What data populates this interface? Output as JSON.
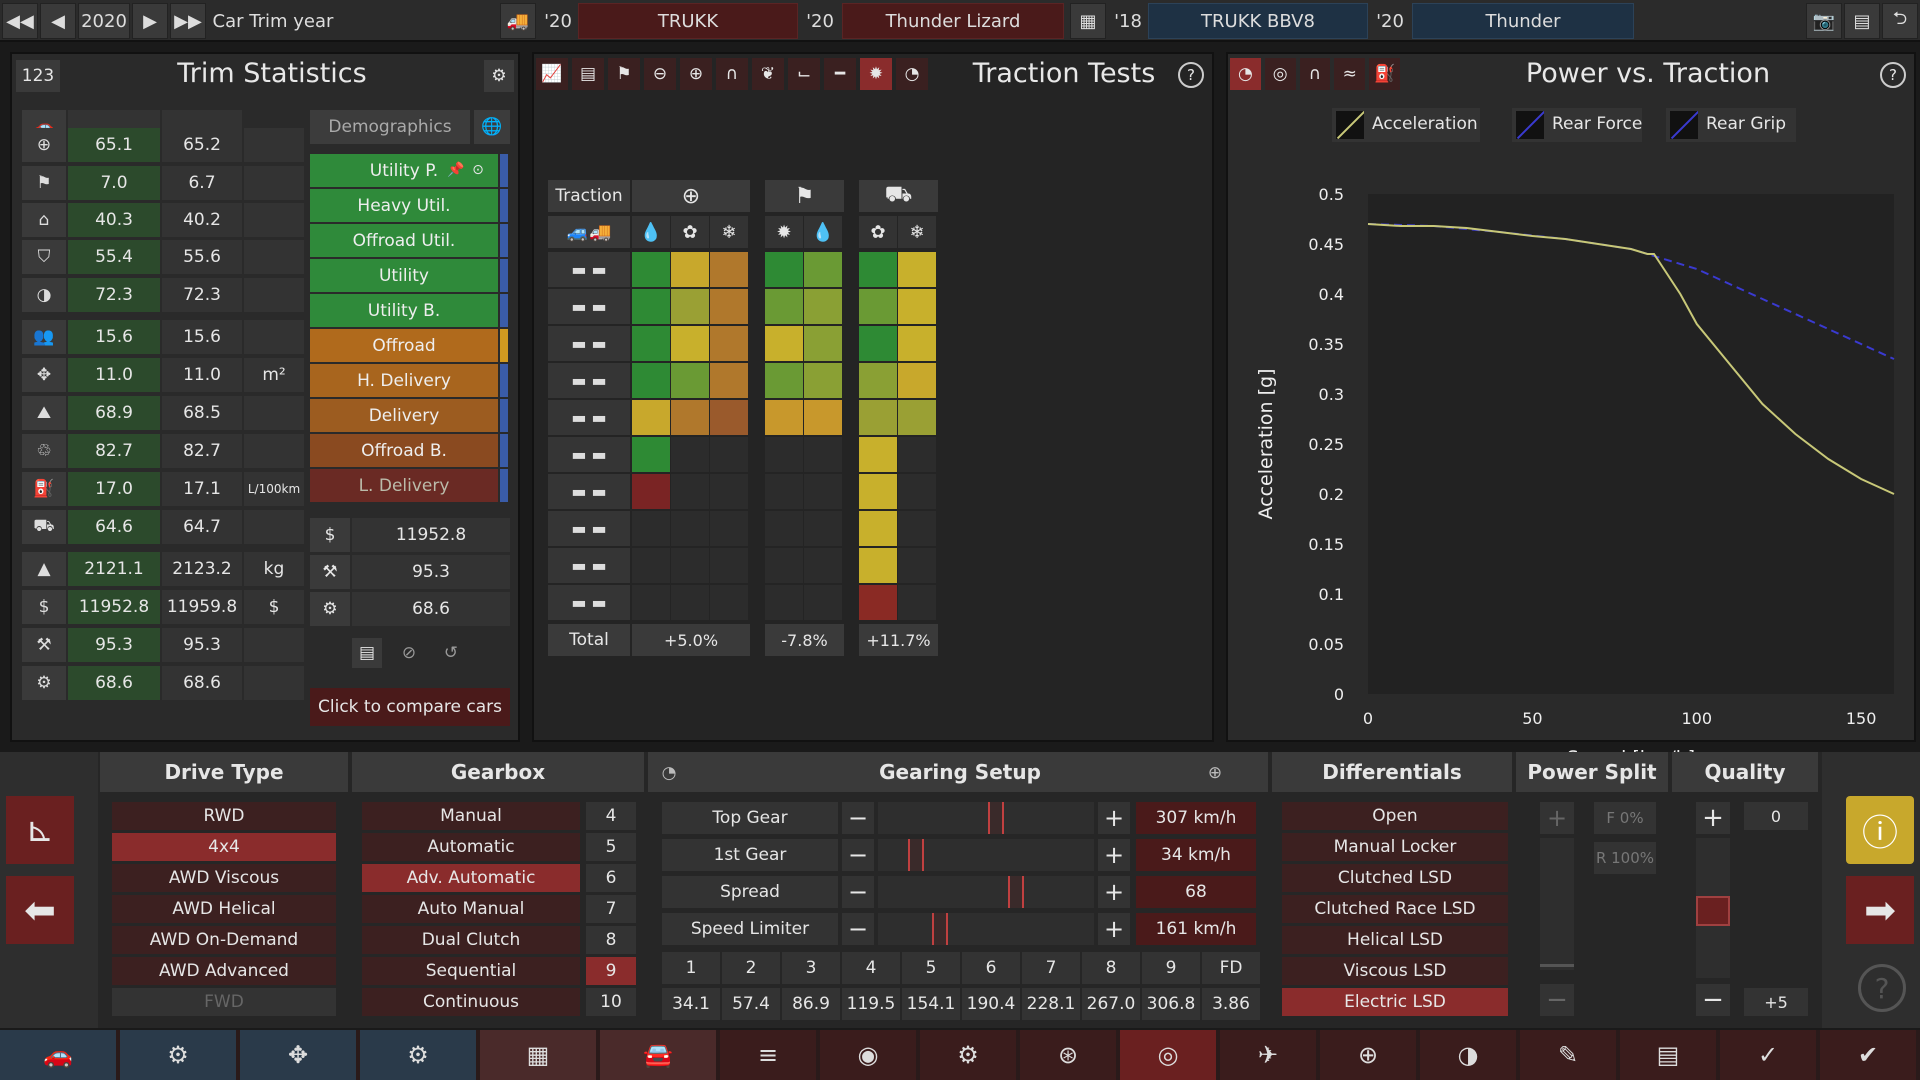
{
  "topbar": {
    "year": "2020",
    "mode_label": "Car Trim year",
    "slots": [
      {
        "year": "'20",
        "name": "TRUKK",
        "color": "red"
      },
      {
        "year": "'20",
        "name": "Thunder Lizard",
        "color": "red"
      },
      {
        "year": "'18",
        "name": "TRUKK BBV8",
        "color": "blue"
      },
      {
        "year": "'20",
        "name": "Thunder",
        "color": "blue"
      }
    ]
  },
  "trim_stats": {
    "badge": "123",
    "title": "Trim Statistics",
    "demographics_label": "Demographics",
    "rows": [
      {
        "icon": "steering-wheel-icon",
        "a": "65.1",
        "b": "65.2",
        "unit": ""
      },
      {
        "icon": "race-flag-icon",
        "a": "7.0",
        "b": "6.7",
        "unit": ""
      },
      {
        "icon": "seat-icon",
        "a": "40.3",
        "b": "40.2",
        "unit": ""
      },
      {
        "icon": "shield-icon",
        "a": "55.4",
        "b": "55.6",
        "unit": ""
      },
      {
        "icon": "safety-icon",
        "a": "72.3",
        "b": "72.3",
        "unit": ""
      },
      {
        "icon": "passengers-icon",
        "a": "15.6",
        "b": "15.6",
        "unit": ""
      },
      {
        "icon": "cargo-volume-icon",
        "a": "11.0",
        "b": "11.0",
        "unit": "m²"
      },
      {
        "icon": "offroad-icon",
        "a": "68.9",
        "b": "68.5",
        "unit": ""
      },
      {
        "icon": "environment-icon",
        "a": "82.7",
        "b": "82.7",
        "unit": ""
      },
      {
        "icon": "fuel-icon",
        "a": "17.0",
        "b": "17.1",
        "unit": "L/100km"
      },
      {
        "icon": "towing-icon",
        "a": "64.6",
        "b": "64.7",
        "unit": ""
      },
      {
        "icon": "weight-icon",
        "a": "2121.1",
        "b": "2123.2",
        "unit": "kg"
      },
      {
        "icon": "cost-icon",
        "a": "11952.8",
        "b": "11959.8",
        "unit": "$"
      },
      {
        "icon": "production-icon",
        "a": "95.3",
        "b": "95.3",
        "unit": ""
      },
      {
        "icon": "service-icon",
        "a": "68.6",
        "b": "68.6",
        "unit": ""
      }
    ],
    "demographics": [
      {
        "label": "Utility P.",
        "color": "#2f8a3a",
        "bar": "#3a5ca8"
      },
      {
        "label": "Heavy Util.",
        "color": "#2f8a3a",
        "bar": "#3a5ca8"
      },
      {
        "label": "Offroad Util.",
        "color": "#2f8a3a",
        "bar": "#3a5ca8"
      },
      {
        "label": "Utility",
        "color": "#2f8a3a",
        "bar": "#3a5ca8"
      },
      {
        "label": "Utility B.",
        "color": "#2f8a3a",
        "bar": "#3a5ca8"
      },
      {
        "label": "Offroad",
        "color": "#b06a1c",
        "bar": "#d09a20"
      },
      {
        "label": "H. Delivery",
        "color": "#a8651e",
        "bar": "#3a5ca8"
      },
      {
        "label": "Delivery",
        "color": "#9c5c20",
        "bar": "#3a5ca8"
      },
      {
        "label": "Offroad B.",
        "color": "#8a4a20",
        "bar": "#3a5ca8"
      },
      {
        "label": "L. Delivery",
        "color": "#6a2a24",
        "bar": "#3a5ca8"
      }
    ],
    "summary": [
      {
        "icon": "cost-icon",
        "value": "11952.8"
      },
      {
        "icon": "production-icon",
        "value": "95.3"
      },
      {
        "icon": "service-icon",
        "value": "68.6"
      }
    ],
    "compare_label": "Click to compare cars"
  },
  "traction_tests": {
    "title": "Traction Tests",
    "header_label": "Traction",
    "total_label": "Total",
    "totals": [
      "+5.0%",
      "-7.8%",
      "+11.7%"
    ],
    "columns": [
      "wet",
      "gravel",
      "snow",
      "dry",
      "wet",
      "gravel",
      "snow"
    ],
    "rows": [
      [
        "#2e8a34",
        "#c8a82c",
        "#b0782c",
        "#2e8a34",
        "#6a9a34",
        "#2e8a34",
        "#c8b02c"
      ],
      [
        "#2e8a34",
        "#9aa034",
        "#b0782c",
        "#6a9a34",
        "#8aa034",
        "#6a9a34",
        "#c8b02c"
      ],
      [
        "#2e8a34",
        "#c8b02c",
        "#b0782c",
        "#c8b02c",
        "#8aa034",
        "#2e8a34",
        "#c8b02c"
      ],
      [
        "#2e8a34",
        "#6a9a34",
        "#b0782c",
        "#6a9a34",
        "#8aa034",
        "#8aa034",
        "#c8a82c"
      ],
      [
        "#c8a82c",
        "#b0782c",
        "#9a5a2c",
        "#c8982c",
        "#c8982c",
        "#9aa034",
        "#9aa034"
      ],
      [
        "#2e8a34",
        "",
        "",
        "",
        "",
        "#c8b02c",
        ""
      ],
      [
        "#7a2424",
        "",
        "",
        "",
        "",
        "#c8b02c",
        ""
      ],
      [
        "",
        "",
        "",
        "",
        "",
        "#c8b02c",
        ""
      ],
      [
        "",
        "",
        "",
        "",
        "",
        "#c8b02c",
        ""
      ],
      [
        "",
        "",
        "",
        "",
        "",
        "#8a2a24",
        ""
      ]
    ]
  },
  "power_traction": {
    "title": "Power vs. Traction",
    "legend": [
      {
        "label": "Acceleration",
        "color": "#c8c878"
      },
      {
        "label": "Rear Force",
        "color": "#3a3ad0"
      },
      {
        "label": "Rear Grip",
        "color": "#3a3ad0"
      }
    ]
  },
  "chart_data": {
    "type": "line",
    "title": "Power vs. Traction",
    "xlabel": "Speed [km/h]",
    "ylabel": "Acceleration [g]",
    "xlim": [
      0,
      160
    ],
    "ylim": [
      0,
      0.5
    ],
    "xticks": [
      0,
      50,
      100,
      150
    ],
    "yticks": [
      0,
      0.05,
      0.1,
      0.15,
      0.2,
      0.25,
      0.3,
      0.35,
      0.4,
      0.45,
      0.5
    ],
    "series": [
      {
        "name": "Acceleration",
        "color": "#c8c878",
        "style": "solid",
        "x": [
          0,
          10,
          20,
          30,
          40,
          50,
          60,
          70,
          80,
          85,
          87,
          90,
          95,
          100,
          110,
          120,
          130,
          140,
          150,
          160
        ],
        "y": [
          0.47,
          0.468,
          0.468,
          0.466,
          0.462,
          0.458,
          0.455,
          0.45,
          0.445,
          0.44,
          0.44,
          0.425,
          0.4,
          0.37,
          0.33,
          0.29,
          0.26,
          0.235,
          0.215,
          0.2
        ]
      },
      {
        "name": "Rear Grip",
        "color": "#3a3ad0",
        "style": "dashed",
        "x": [
          0,
          20,
          40,
          60,
          80,
          90,
          100,
          110,
          120,
          130,
          140,
          150,
          160
        ],
        "y": [
          0.47,
          0.468,
          0.462,
          0.455,
          0.445,
          0.435,
          0.425,
          0.41,
          0.395,
          0.38,
          0.365,
          0.35,
          0.335
        ]
      }
    ]
  },
  "drivetype": {
    "title": "Drive Type",
    "options": [
      "RWD",
      "4x4",
      "AWD Viscous",
      "AWD Helical",
      "AWD On-Demand",
      "AWD Advanced",
      "FWD"
    ],
    "selected": "4x4",
    "disabled": [
      "FWD"
    ]
  },
  "gearbox": {
    "title": "Gearbox",
    "options": [
      "Manual",
      "Automatic",
      "Adv. Automatic",
      "Auto Manual",
      "Dual Clutch",
      "Sequential",
      "Continuous"
    ],
    "selected": "Adv. Automatic",
    "gears": [
      "4",
      "5",
      "6",
      "7",
      "8",
      "9",
      "10"
    ],
    "selected_gear": "9"
  },
  "gearing": {
    "title": "Gearing Setup",
    "rows": [
      {
        "label": "Top Gear",
        "value": "307 km/h",
        "pos": 0.55
      },
      {
        "label": "1st Gear",
        "value": "34 km/h",
        "pos": 0.15
      },
      {
        "label": "Spread",
        "value": "68",
        "pos": 0.65
      },
      {
        "label": "Speed Limiter",
        "value": "161 km/h",
        "pos": 0.27
      }
    ],
    "ratio_headers": [
      "1",
      "2",
      "3",
      "4",
      "5",
      "6",
      "7",
      "8",
      "9",
      "FD"
    ],
    "ratio_values": [
      "34.1",
      "57.4",
      "86.9",
      "119.5",
      "154.1",
      "190.4",
      "228.1",
      "267.0",
      "306.8",
      "3.86"
    ]
  },
  "differentials": {
    "title": "Differentials",
    "options": [
      "Open",
      "Manual Locker",
      "Clutched LSD",
      "Clutched Race LSD",
      "Helical LSD",
      "Viscous LSD",
      "Electric LSD"
    ],
    "selected": "Electric LSD"
  },
  "power_split": {
    "title": "Power Split",
    "front": "F 0%",
    "rear": "R 100%"
  },
  "quality": {
    "title": "Quality",
    "value": "0",
    "bonus": "+5"
  },
  "bottom_nav": [
    "car-body-icon",
    "fixtures-icon",
    "engineering-icon",
    "tuning-icon",
    "trim-icon",
    "chassis-icon",
    "suspension-icon",
    "brakes-icon",
    "engine-icon",
    "wheels-icon",
    "tyres-icon",
    "aero-icon",
    "interior-icon",
    "safety-icon",
    "fuel-icon",
    "paint-icon",
    "testing-icon",
    "finish-icon"
  ]
}
